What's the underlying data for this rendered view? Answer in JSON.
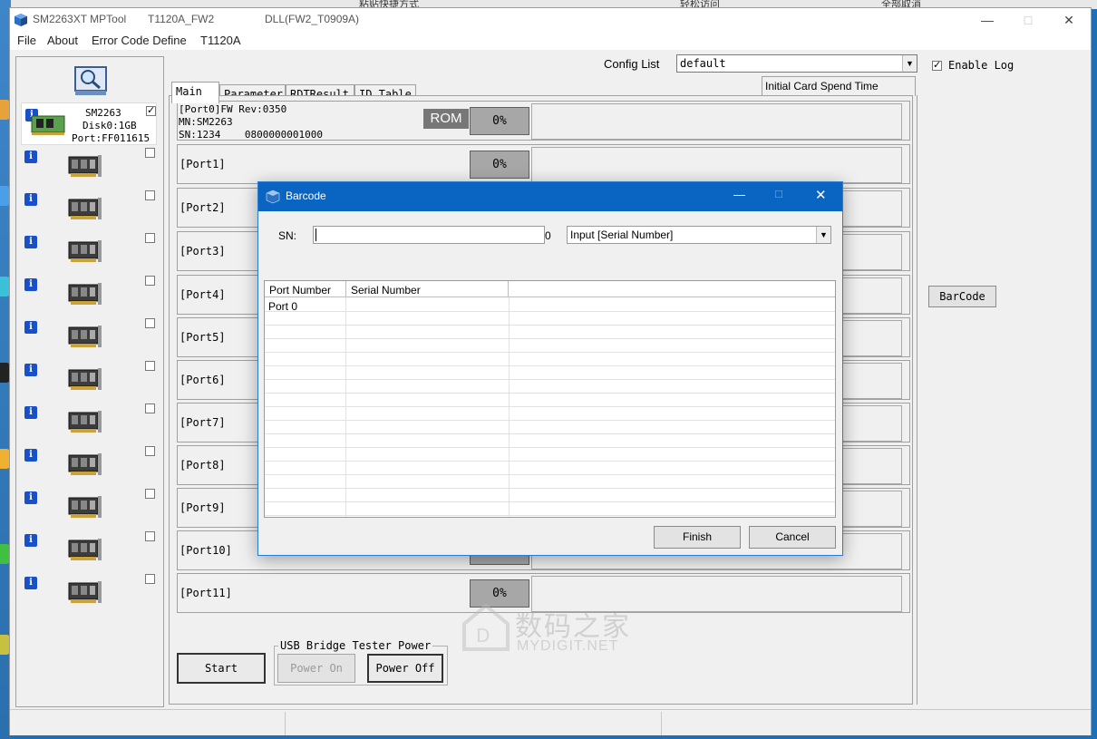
{
  "window": {
    "title": "SM2263XT MPTool",
    "firmware": "T1120A_FW2",
    "dll": "DLL(FW2_T0909A)"
  },
  "menu": [
    "File",
    "About",
    "Error Code Define",
    "T1120A"
  ],
  "config": {
    "label": "Config List",
    "value": "default",
    "enable_log_label": "Enable Log",
    "enable_log_checked": true,
    "initial_card_spend_time": "Initial Card Spend Time"
  },
  "tabs": [
    "Main",
    "Parameter",
    "RDTResult",
    "ID Table"
  ],
  "left_panel": {
    "port0": {
      "model": "SM2263",
      "disk": "Disk0:1GB",
      "port": "Port:FF011615",
      "checked": true
    }
  },
  "port0": {
    "line1": "[Port0]FW Rev:0350",
    "line2": "MN:SM2263",
    "line3": "SN:1234    0800000001000",
    "rom_badge": "ROM",
    "progress": "0%"
  },
  "ports": [
    {
      "label": "[Port1]",
      "progress": "0%"
    },
    {
      "label": "[Port2]",
      "progress": ""
    },
    {
      "label": "[Port3]",
      "progress": ""
    },
    {
      "label": "[Port4]",
      "progress": ""
    },
    {
      "label": "[Port5]",
      "progress": ""
    },
    {
      "label": "[Port6]",
      "progress": ""
    },
    {
      "label": "[Port7]",
      "progress": ""
    },
    {
      "label": "[Port8]",
      "progress": ""
    },
    {
      "label": "[Port9]",
      "progress": ""
    },
    {
      "label": "[Port10]",
      "progress": ""
    },
    {
      "label": "[Port11]",
      "progress": "0%"
    }
  ],
  "buttons": {
    "start": "Start",
    "barcode": "BarCode",
    "usb_group": "USB Bridge Tester Power",
    "power_on": "Power On",
    "power_off": "Power Off"
  },
  "dialog": {
    "title": "Barcode",
    "sn_label": "SN:",
    "sn_value": "",
    "sn_count": "0",
    "input_mode": "Input [Serial Number]",
    "columns": [
      "Port Number",
      "Serial Number"
    ],
    "rows": [
      {
        "port": "Port 0",
        "serial": ""
      }
    ],
    "finish": "Finish",
    "cancel": "Cancel"
  },
  "watermark": {
    "cn": "数码之家",
    "en": "MYDIGIT.NET"
  },
  "top_strip": [
    "粘贴快捷方式",
    "轻松访问",
    "全部取消"
  ]
}
